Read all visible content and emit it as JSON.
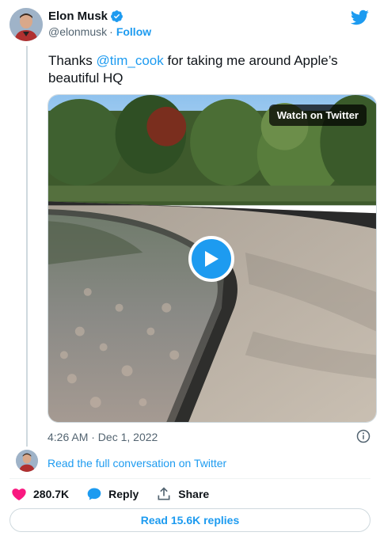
{
  "author": {
    "name": "Elon Musk",
    "handle": "@elonmusk",
    "separator": "·",
    "follow_label": "Follow"
  },
  "tweet": {
    "text_before": "Thanks ",
    "mention": "@tim_cook",
    "text_after": " for taking me around Apple’s beautiful HQ"
  },
  "media": {
    "watch_label": "Watch on Twitter"
  },
  "meta": {
    "timestamp": "4:26 AM · Dec 1, 2022"
  },
  "conversation": {
    "read_label": "Read the full conversation on Twitter"
  },
  "actions": {
    "likes": "280.7K",
    "reply_label": "Reply",
    "share_label": "Share"
  },
  "replies": {
    "read_label": "Read 15.6K replies"
  },
  "colors": {
    "accent": "#1d9bf0",
    "like": "#f91880",
    "text": "#0f1419",
    "muted": "#536471"
  },
  "icons": [
    "verified-badge-icon",
    "twitter-bird-icon",
    "play-icon",
    "info-icon",
    "heart-icon",
    "reply-bubble-icon",
    "share-icon"
  ]
}
